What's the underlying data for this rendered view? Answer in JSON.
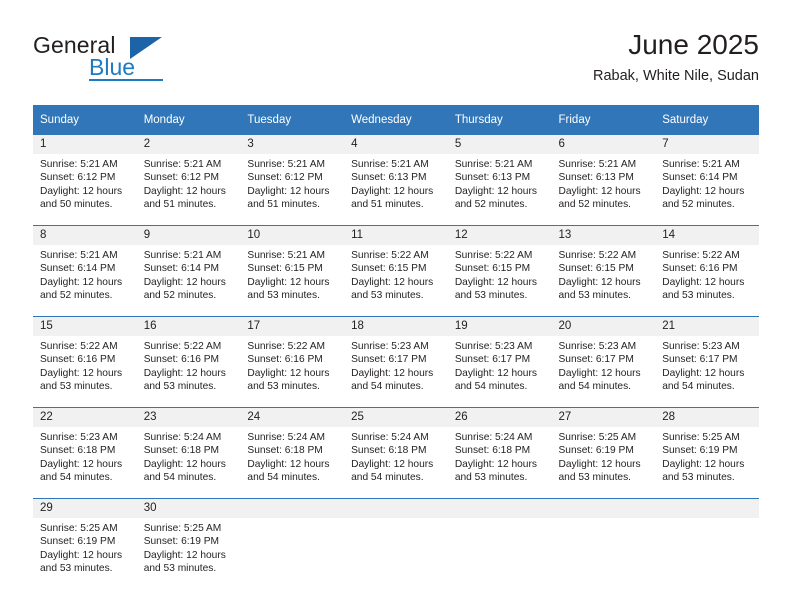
{
  "brand": {
    "name_part1": "General",
    "name_part2": "Blue",
    "triangle_color": "#1c63a8",
    "blue_color": "#1f7bc1"
  },
  "header": {
    "title": "June 2025",
    "location": "Rabak, White Nile, Sudan"
  },
  "theme": {
    "header_blue": "#3176b8",
    "daynum_band": "#f1f1f1",
    "text": "#231f20"
  },
  "weekday_headers": [
    "Sunday",
    "Monday",
    "Tuesday",
    "Wednesday",
    "Thursday",
    "Friday",
    "Saturday"
  ],
  "weeks": [
    {
      "days": [
        {
          "date": "1",
          "sunrise": "Sunrise: 5:21 AM",
          "sunset": "Sunset: 6:12 PM",
          "daylight_line1": "Daylight: 12 hours",
          "daylight_line2": "and 50 minutes."
        },
        {
          "date": "2",
          "sunrise": "Sunrise: 5:21 AM",
          "sunset": "Sunset: 6:12 PM",
          "daylight_line1": "Daylight: 12 hours",
          "daylight_line2": "and 51 minutes."
        },
        {
          "date": "3",
          "sunrise": "Sunrise: 5:21 AM",
          "sunset": "Sunset: 6:12 PM",
          "daylight_line1": "Daylight: 12 hours",
          "daylight_line2": "and 51 minutes."
        },
        {
          "date": "4",
          "sunrise": "Sunrise: 5:21 AM",
          "sunset": "Sunset: 6:13 PM",
          "daylight_line1": "Daylight: 12 hours",
          "daylight_line2": "and 51 minutes."
        },
        {
          "date": "5",
          "sunrise": "Sunrise: 5:21 AM",
          "sunset": "Sunset: 6:13 PM",
          "daylight_line1": "Daylight: 12 hours",
          "daylight_line2": "and 52 minutes."
        },
        {
          "date": "6",
          "sunrise": "Sunrise: 5:21 AM",
          "sunset": "Sunset: 6:13 PM",
          "daylight_line1": "Daylight: 12 hours",
          "daylight_line2": "and 52 minutes."
        },
        {
          "date": "7",
          "sunrise": "Sunrise: 5:21 AM",
          "sunset": "Sunset: 6:14 PM",
          "daylight_line1": "Daylight: 12 hours",
          "daylight_line2": "and 52 minutes."
        }
      ]
    },
    {
      "days": [
        {
          "date": "8",
          "sunrise": "Sunrise: 5:21 AM",
          "sunset": "Sunset: 6:14 PM",
          "daylight_line1": "Daylight: 12 hours",
          "daylight_line2": "and 52 minutes."
        },
        {
          "date": "9",
          "sunrise": "Sunrise: 5:21 AM",
          "sunset": "Sunset: 6:14 PM",
          "daylight_line1": "Daylight: 12 hours",
          "daylight_line2": "and 52 minutes."
        },
        {
          "date": "10",
          "sunrise": "Sunrise: 5:21 AM",
          "sunset": "Sunset: 6:15 PM",
          "daylight_line1": "Daylight: 12 hours",
          "daylight_line2": "and 53 minutes."
        },
        {
          "date": "11",
          "sunrise": "Sunrise: 5:22 AM",
          "sunset": "Sunset: 6:15 PM",
          "daylight_line1": "Daylight: 12 hours",
          "daylight_line2": "and 53 minutes."
        },
        {
          "date": "12",
          "sunrise": "Sunrise: 5:22 AM",
          "sunset": "Sunset: 6:15 PM",
          "daylight_line1": "Daylight: 12 hours",
          "daylight_line2": "and 53 minutes."
        },
        {
          "date": "13",
          "sunrise": "Sunrise: 5:22 AM",
          "sunset": "Sunset: 6:15 PM",
          "daylight_line1": "Daylight: 12 hours",
          "daylight_line2": "and 53 minutes."
        },
        {
          "date": "14",
          "sunrise": "Sunrise: 5:22 AM",
          "sunset": "Sunset: 6:16 PM",
          "daylight_line1": "Daylight: 12 hours",
          "daylight_line2": "and 53 minutes."
        }
      ]
    },
    {
      "days": [
        {
          "date": "15",
          "sunrise": "Sunrise: 5:22 AM",
          "sunset": "Sunset: 6:16 PM",
          "daylight_line1": "Daylight: 12 hours",
          "daylight_line2": "and 53 minutes."
        },
        {
          "date": "16",
          "sunrise": "Sunrise: 5:22 AM",
          "sunset": "Sunset: 6:16 PM",
          "daylight_line1": "Daylight: 12 hours",
          "daylight_line2": "and 53 minutes."
        },
        {
          "date": "17",
          "sunrise": "Sunrise: 5:22 AM",
          "sunset": "Sunset: 6:16 PM",
          "daylight_line1": "Daylight: 12 hours",
          "daylight_line2": "and 53 minutes."
        },
        {
          "date": "18",
          "sunrise": "Sunrise: 5:23 AM",
          "sunset": "Sunset: 6:17 PM",
          "daylight_line1": "Daylight: 12 hours",
          "daylight_line2": "and 54 minutes."
        },
        {
          "date": "19",
          "sunrise": "Sunrise: 5:23 AM",
          "sunset": "Sunset: 6:17 PM",
          "daylight_line1": "Daylight: 12 hours",
          "daylight_line2": "and 54 minutes."
        },
        {
          "date": "20",
          "sunrise": "Sunrise: 5:23 AM",
          "sunset": "Sunset: 6:17 PM",
          "daylight_line1": "Daylight: 12 hours",
          "daylight_line2": "and 54 minutes."
        },
        {
          "date": "21",
          "sunrise": "Sunrise: 5:23 AM",
          "sunset": "Sunset: 6:17 PM",
          "daylight_line1": "Daylight: 12 hours",
          "daylight_line2": "and 54 minutes."
        }
      ]
    },
    {
      "days": [
        {
          "date": "22",
          "sunrise": "Sunrise: 5:23 AM",
          "sunset": "Sunset: 6:18 PM",
          "daylight_line1": "Daylight: 12 hours",
          "daylight_line2": "and 54 minutes."
        },
        {
          "date": "23",
          "sunrise": "Sunrise: 5:24 AM",
          "sunset": "Sunset: 6:18 PM",
          "daylight_line1": "Daylight: 12 hours",
          "daylight_line2": "and 54 minutes."
        },
        {
          "date": "24",
          "sunrise": "Sunrise: 5:24 AM",
          "sunset": "Sunset: 6:18 PM",
          "daylight_line1": "Daylight: 12 hours",
          "daylight_line2": "and 54 minutes."
        },
        {
          "date": "25",
          "sunrise": "Sunrise: 5:24 AM",
          "sunset": "Sunset: 6:18 PM",
          "daylight_line1": "Daylight: 12 hours",
          "daylight_line2": "and 54 minutes."
        },
        {
          "date": "26",
          "sunrise": "Sunrise: 5:24 AM",
          "sunset": "Sunset: 6:18 PM",
          "daylight_line1": "Daylight: 12 hours",
          "daylight_line2": "and 53 minutes."
        },
        {
          "date": "27",
          "sunrise": "Sunrise: 5:25 AM",
          "sunset": "Sunset: 6:19 PM",
          "daylight_line1": "Daylight: 12 hours",
          "daylight_line2": "and 53 minutes."
        },
        {
          "date": "28",
          "sunrise": "Sunrise: 5:25 AM",
          "sunset": "Sunset: 6:19 PM",
          "daylight_line1": "Daylight: 12 hours",
          "daylight_line2": "and 53 minutes."
        }
      ]
    },
    {
      "days": [
        {
          "date": "29",
          "sunrise": "Sunrise: 5:25 AM",
          "sunset": "Sunset: 6:19 PM",
          "daylight_line1": "Daylight: 12 hours",
          "daylight_line2": "and 53 minutes."
        },
        {
          "date": "30",
          "sunrise": "Sunrise: 5:25 AM",
          "sunset": "Sunset: 6:19 PM",
          "daylight_line1": "Daylight: 12 hours",
          "daylight_line2": "and 53 minutes."
        },
        {
          "date": "",
          "sunrise": "",
          "sunset": "",
          "daylight_line1": "",
          "daylight_line2": ""
        },
        {
          "date": "",
          "sunrise": "",
          "sunset": "",
          "daylight_line1": "",
          "daylight_line2": ""
        },
        {
          "date": "",
          "sunrise": "",
          "sunset": "",
          "daylight_line1": "",
          "daylight_line2": ""
        },
        {
          "date": "",
          "sunrise": "",
          "sunset": "",
          "daylight_line1": "",
          "daylight_line2": ""
        },
        {
          "date": "",
          "sunrise": "",
          "sunset": "",
          "daylight_line1": "",
          "daylight_line2": ""
        }
      ]
    }
  ]
}
